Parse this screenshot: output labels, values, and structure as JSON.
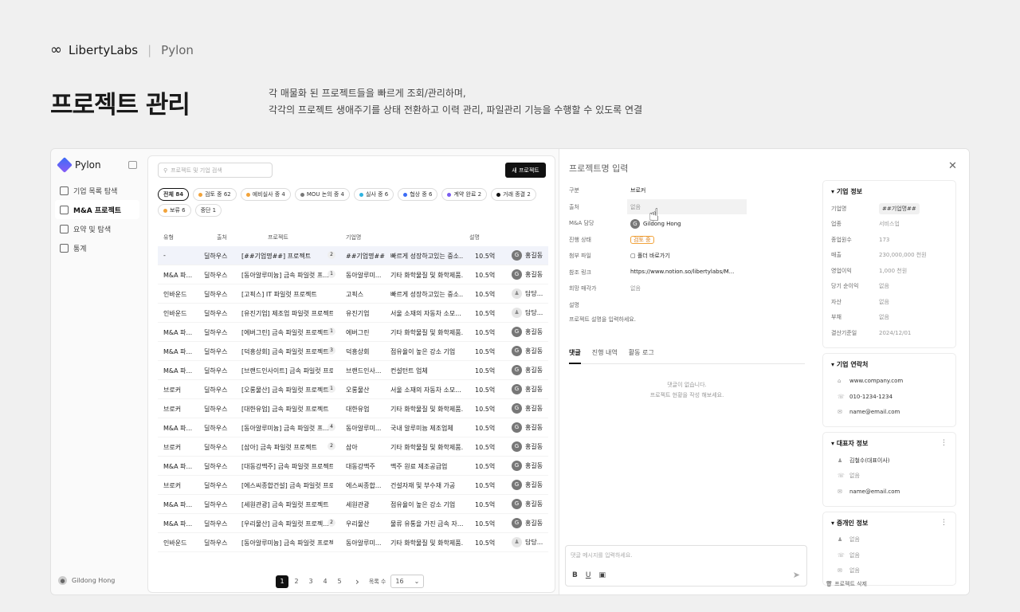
{
  "header": {
    "brand": "LibertyLabs",
    "product": "Pylon",
    "title": "프로젝트 관리",
    "desc1": "각 매물화 된 프로젝트들을 빠르게 조회/관리하며,",
    "desc2": "각각의 프로젝트 생애주기를 상태 전환하고 이력 관리, 파일관리 기능을 수행할 수 있도록 연결"
  },
  "sidebar": {
    "brand": "Pylon",
    "items": [
      {
        "label": "기업 목록 탐색"
      },
      {
        "label": "M&A 프로젝트"
      },
      {
        "label": "요약 및 탐색"
      },
      {
        "label": "통계"
      }
    ],
    "user": "Gildong Hong"
  },
  "list": {
    "search_placeholder": "프로젝트 및 기업 검색",
    "new_button": "새 프로젝트",
    "filters": [
      {
        "label": "전체 84",
        "color": ""
      },
      {
        "label": "검토 중 62",
        "color": "#f2a33a"
      },
      {
        "label": "예비실사 중 4",
        "color": "#f2a33a"
      },
      {
        "label": "MOU 논의 중 4",
        "color": "#777777"
      },
      {
        "label": "실사 중 6",
        "color": "#2fb3e0"
      },
      {
        "label": "협상 중 6",
        "color": "#3b6cf6"
      },
      {
        "label": "계약 완료 2",
        "color": "#7a5cf0"
      },
      {
        "label": "거래 종결 2",
        "color": "#111111"
      },
      {
        "label": "보류 6",
        "color": "#f2a33a"
      },
      {
        "label": "중단 1",
        "color": ""
      }
    ],
    "columns": [
      "유형",
      "출처",
      "프로젝트",
      "기업명",
      "설명"
    ],
    "rows": [
      {
        "type": "-",
        "source": "딜하우스",
        "project": "[##기업명##] 프로젝트",
        "count": "2",
        "company": "##기업명##",
        "desc": "빠르게 성장하고있는 중소...",
        "amount": "10.5억",
        "assignee": "홍길동",
        "initial": "G"
      },
      {
        "type": "M&A 파...",
        "source": "딜하우스",
        "project": "[동아알루미늄] 금속 파일럿 프...",
        "count": "1",
        "company": "동아알루미...",
        "desc": "기타 화학물질 및 화학제품...",
        "amount": "10.5억",
        "assignee": "홍길동",
        "initial": "G"
      },
      {
        "type": "인바운드",
        "source": "딜하우스",
        "project": "[고픽스] IT 파일럿 프로젝트",
        "count": "",
        "company": "고픽스",
        "desc": "빠르게 성장하고있는 중소...",
        "amount": "10.5억",
        "assignee": "담당...",
        "initial": ""
      },
      {
        "type": "인바운드",
        "source": "딜하우스",
        "project": "[유진기업] 제조업 파일럿 프로젝트",
        "count": "",
        "company": "유진기업",
        "desc": "서울 소재의 자동차 소모...",
        "amount": "10.5억",
        "assignee": "담당...",
        "initial": ""
      },
      {
        "type": "M&A 파...",
        "source": "딜하우스",
        "project": "[에버그린] 금속 파일럿 프로젝트",
        "count": "1",
        "company": "에버그린",
        "desc": "기타 화학물질 및 화학제품...",
        "amount": "10.5억",
        "assignee": "홍길동",
        "initial": "G"
      },
      {
        "type": "M&A 파...",
        "source": "딜하우스",
        "project": "[덕흥상회] 금속 파일럿 프로젝트",
        "count": "3",
        "company": "덕흥상회",
        "desc": "점유율이 높은 강소 기업",
        "amount": "10.5억",
        "assignee": "홍길동",
        "initial": "G"
      },
      {
        "type": "M&A 파...",
        "source": "딜하우스",
        "project": "[브랜드인사이트] 금속 파일럿 프로...",
        "count": "",
        "company": "브랜드인사...",
        "desc": "컨설턴트 업체",
        "amount": "10.5억",
        "assignee": "홍길동",
        "initial": "G"
      },
      {
        "type": "브로커",
        "source": "딜하우스",
        "project": "[오롱물산] 금속 파일럿 프로젝트",
        "count": "1",
        "company": "오롱물산",
        "desc": "서울 소재의 자동차 소모...",
        "amount": "10.5억",
        "assignee": "홍길동",
        "initial": "G"
      },
      {
        "type": "브로커",
        "source": "딜하우스",
        "project": "[대한유업] 금속 파일럿 프로젝트",
        "count": "",
        "company": "대한유업",
        "desc": "기타 화학물질 및 화학제품...",
        "amount": "10.5억",
        "assignee": "홍길동",
        "initial": "G"
      },
      {
        "type": "M&A 파...",
        "source": "딜하우스",
        "project": "[동아알루미늄] 금속 파일럿 프...",
        "count": "4",
        "company": "동아알루미...",
        "desc": "국내 알루미늄 제조업체",
        "amount": "10.5억",
        "assignee": "홍길동",
        "initial": "G"
      },
      {
        "type": "브로커",
        "source": "딜하우스",
        "project": "[삼아] 금속 파일럿 프로젝트",
        "count": "2",
        "company": "삼아",
        "desc": "기타 화학물질 및 화학제품...",
        "amount": "10.5억",
        "assignee": "홍길동",
        "initial": "G"
      },
      {
        "type": "M&A 파...",
        "source": "딜하우스",
        "project": "[대동강맥주] 금속 파일럿 프로젝트",
        "count": "",
        "company": "대동강맥주",
        "desc": "맥주 원료 제조공급업",
        "amount": "10.5억",
        "assignee": "홍길동",
        "initial": "G"
      },
      {
        "type": "브로커",
        "source": "딜하우스",
        "project": "[에스씨종합건설] 금속 파일럿 프로...",
        "count": "",
        "company": "에스씨종합...",
        "desc": "건설자재 및 부수재 가공",
        "amount": "10.5억",
        "assignee": "홍길동",
        "initial": "G"
      },
      {
        "type": "M&A 파...",
        "source": "딜하우스",
        "project": "[세원관광] 금속 파일럿 프로젝트",
        "count": "",
        "company": "세원관광",
        "desc": "점유율이 높은 강소 기업",
        "amount": "10.5억",
        "assignee": "홍길동",
        "initial": "G"
      },
      {
        "type": "M&A 파...",
        "source": "딜하우스",
        "project": "[우리물산] 금속 파일럿 프로젝...",
        "count": "2",
        "company": "우리물산",
        "desc": "물류 유통을 가진 금속 자...",
        "amount": "10.5억",
        "assignee": "홍길동",
        "initial": "G"
      },
      {
        "type": "인바운드",
        "source": "딜하우스",
        "project": "[동아알루미늄] 금속 파일럿 프로젝...",
        "count": "",
        "company": "동아알루미...",
        "desc": "기타 화학물질 및 화학제품...",
        "amount": "10.5억",
        "assignee": "담당...",
        "initial": ""
      }
    ],
    "pager": {
      "pages": [
        "1",
        "2",
        "3",
        "4",
        "5"
      ],
      "next": "›",
      "size_label": "목록 수",
      "size_value": "16"
    }
  },
  "detail": {
    "title": "프로젝트명 입력",
    "props": [
      {
        "k": "구분",
        "v": "브로커"
      },
      {
        "k": "출처",
        "v": "없음"
      },
      {
        "k": "M&A 담당",
        "v": "Gildong Hong"
      },
      {
        "k": "진행 상태",
        "v": "검토 중"
      },
      {
        "k": "첨부 파일",
        "v": "폴더 바로가기"
      },
      {
        "k": "참조 링크",
        "v": "https://www.notion.so/libertylabs/M..."
      },
      {
        "k": "희망 매각가",
        "v": "없음"
      },
      {
        "k": "설명",
        "v": ""
      }
    ],
    "desc_placeholder": "프로젝트 설명을 입력하세요.",
    "tabs": [
      "댓글",
      "진행 내역",
      "활동 로그"
    ],
    "empty1": "댓글이 없습니다.",
    "empty2": "프로젝트 현황을 작성 해보세요.",
    "comment_placeholder": "댓글 메시지를 입력하세요.",
    "company": {
      "title": "기업 정보",
      "fields": [
        {
          "k": "기업명",
          "v": "##기업명##"
        },
        {
          "k": "업종",
          "v": "서비스업"
        },
        {
          "k": "종업원수",
          "v": "173"
        },
        {
          "k": "매출",
          "v": "230,000,000 천원"
        },
        {
          "k": "영업이익",
          "v": "1,000 천원"
        },
        {
          "k": "당기 순이익",
          "v": "없음"
        },
        {
          "k": "자산",
          "v": "없음"
        },
        {
          "k": "부채",
          "v": "없음"
        },
        {
          "k": "결산기준일",
          "v": "2024/12/01"
        }
      ]
    },
    "contact": {
      "title": "기업 연락처",
      "items": [
        "www.company.com",
        "010-1234-1234",
        "name@email.com"
      ]
    },
    "ceo": {
      "title": "대표자 정보",
      "items": [
        "김철수(대표이사)",
        "없음",
        "name@email.com"
      ]
    },
    "broker": {
      "title": "중개인 정보",
      "items": [
        "없음",
        "없음",
        "없음"
      ]
    },
    "delete": "프로젝트 삭제"
  }
}
